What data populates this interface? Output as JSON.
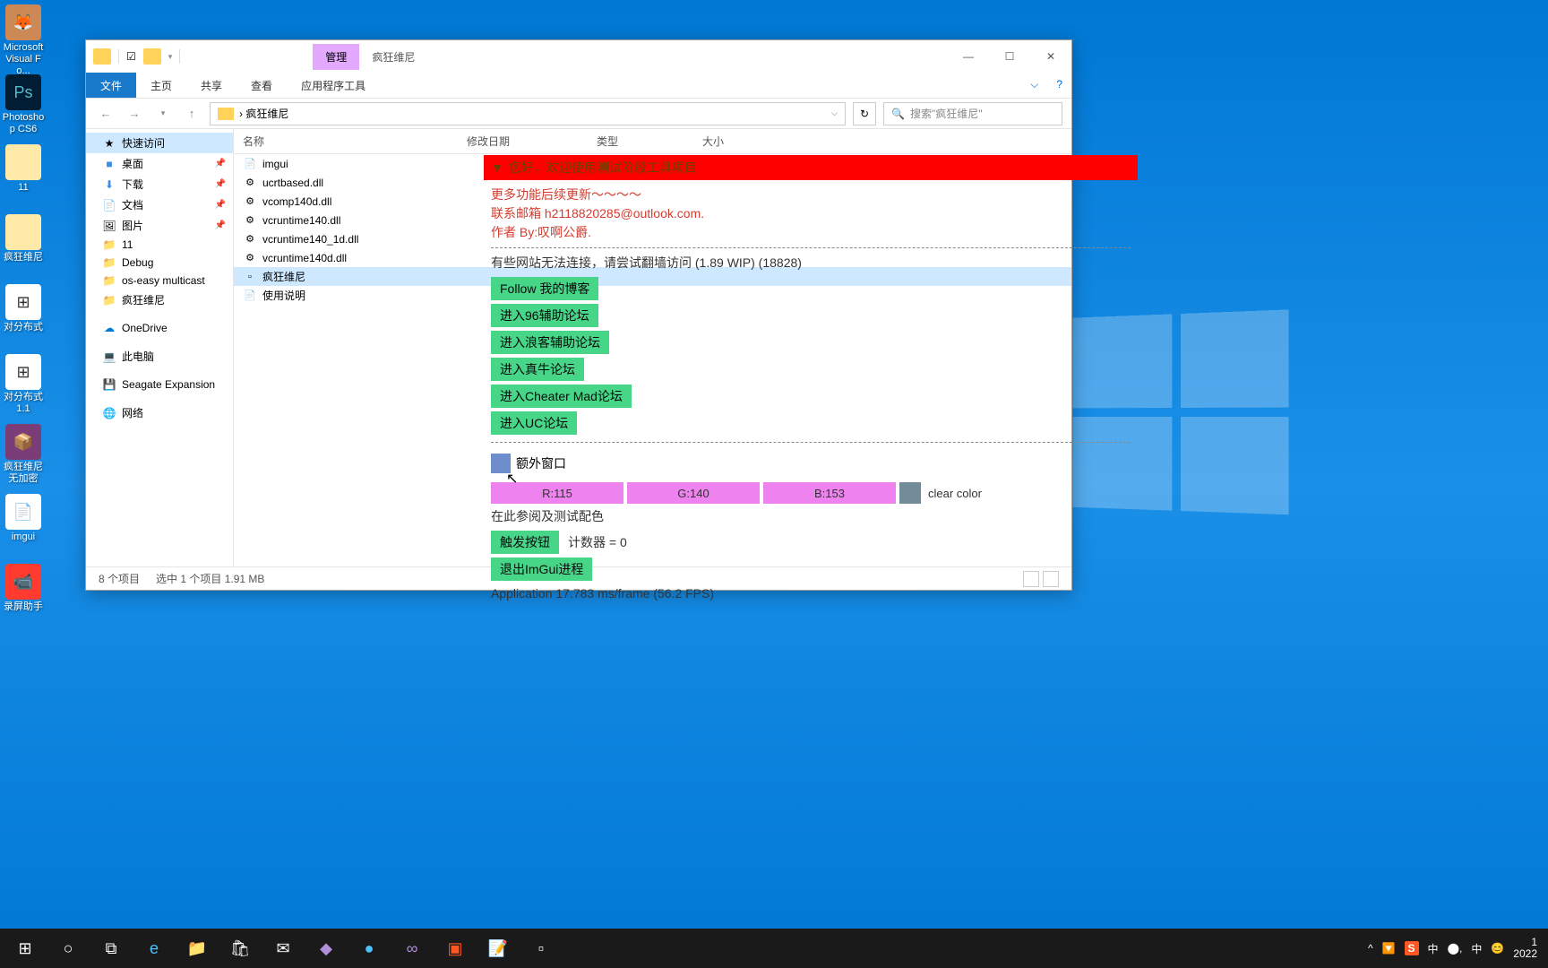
{
  "desktop": {
    "icons": [
      {
        "label": "Microsoft Visual Fo..."
      },
      {
        "label": "Photoshop CS6"
      },
      {
        "label": "11"
      },
      {
        "label": "疯狂维尼"
      },
      {
        "label": "对分布式"
      },
      {
        "label": "对分布式 1.1"
      },
      {
        "label": "疯狂维尼 无加密"
      },
      {
        "label": "imgui"
      },
      {
        "label": "录屏助手"
      }
    ]
  },
  "explorer": {
    "manage_tab": "管理",
    "title": "疯狂维尼",
    "ribbon": {
      "file": "文件",
      "home": "主页",
      "share": "共享",
      "view": "查看",
      "apptools": "应用程序工具"
    },
    "nav": {
      "breadcrumb": "› 疯狂维尼",
      "refresh": "↻",
      "search_placeholder": "搜索\"疯狂维尼\""
    },
    "sidebar": {
      "quick": "快速访问",
      "items": [
        "桌面",
        "下载",
        "文档",
        "图片",
        "11",
        "Debug",
        "os-easy multicast",
        "疯狂维尼"
      ],
      "onedrive": "OneDrive",
      "thispc": "此电脑",
      "seagate": "Seagate Expansion",
      "network": "网络"
    },
    "headers": {
      "name": "名称",
      "date": "修改日期",
      "type": "类型",
      "size": "大小"
    },
    "files": [
      {
        "name": "imgui",
        "selected": false
      },
      {
        "name": "ucrtbased.dll",
        "selected": false
      },
      {
        "name": "vcomp140d.dll",
        "selected": false
      },
      {
        "name": "vcruntime140.dll",
        "selected": false
      },
      {
        "name": "vcruntime140_1d.dll",
        "selected": false
      },
      {
        "name": "vcruntime140d.dll",
        "selected": false
      },
      {
        "name": "疯狂维尼",
        "selected": true
      },
      {
        "name": "使用说明",
        "selected": false
      }
    ],
    "status": {
      "count": "8 个项目",
      "selection": "选中 1 个项目  1.91 MB"
    }
  },
  "imgui": {
    "header": "您好，欢迎使用测试阶段工具项目",
    "line1": "更多功能后续更新～～～～",
    "line2": "联系邮箱 h2118820285@outlook.com.",
    "line3": "作者 By:叹啊公爵.",
    "notice": "有些网站无法连接，请尝试翻墙访问 (1.89 WIP) (18828)",
    "buttons": {
      "blog": "Follow 我的博客",
      "bbs96": "进入96辅助论坛",
      "langke": "进入浪客辅助论坛",
      "zhenniu": "进入真牛论坛",
      "cheatermad": "进入Cheater Mad论坛",
      "uc": "进入UC论坛"
    },
    "extra_window": "额外窗口",
    "color": {
      "r": "R:115",
      "g": "G:140",
      "b": "B:153",
      "label": "clear color"
    },
    "palette_hint": "在此参阅及测试配色",
    "trigger_btn": "触发按钮",
    "counter": "计数器 = 0",
    "exit_btn": "退出ImGui进程",
    "perf": "Application  17.783 ms/frame (56.2 FPS)"
  },
  "taskbar": {
    "tray": {
      "sogou": "S",
      "ime1": "中",
      "ime2": "中",
      "time": "1",
      "date": "2022"
    }
  }
}
